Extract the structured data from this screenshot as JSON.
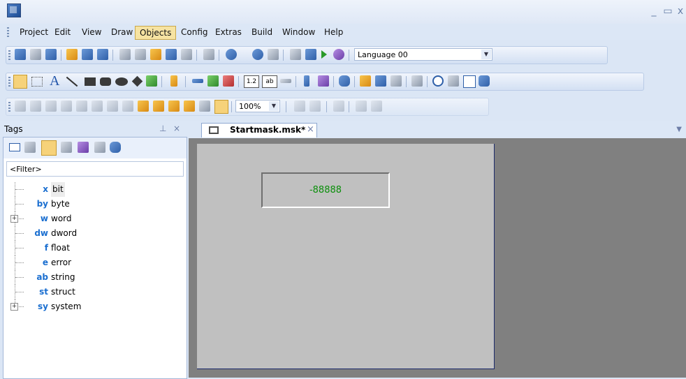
{
  "menu": [
    "Project",
    "Edit",
    "View",
    "Draw",
    "Objects",
    "Config",
    "Extras",
    "Build",
    "Window",
    "Help"
  ],
  "menu_active": "Objects",
  "toolbar1": {
    "language": "Language 00"
  },
  "toolbar3": {
    "zoom": "100%"
  },
  "tags_panel": {
    "title": "Tags",
    "filter_placeholder": "<Filter>",
    "items": [
      {
        "abbr": "x",
        "label": "bit",
        "expandable": false
      },
      {
        "abbr": "by",
        "label": "byte",
        "expandable": false
      },
      {
        "abbr": "w",
        "label": "word",
        "expandable": true
      },
      {
        "abbr": "dw",
        "label": "dword",
        "expandable": false
      },
      {
        "abbr": "f",
        "label": "float",
        "expandable": false
      },
      {
        "abbr": "e",
        "label": "error",
        "expandable": false
      },
      {
        "abbr": "ab",
        "label": "string",
        "expandable": false
      },
      {
        "abbr": "st",
        "label": "struct",
        "expandable": false
      },
      {
        "abbr": "sy",
        "label": "system",
        "expandable": true
      }
    ]
  },
  "document": {
    "tab_title": "Startmask.msk*",
    "display_value": "-88888"
  },
  "colors": {
    "display_text": "#0a8f0a",
    "canvas": "#c0c0c0",
    "workspace": "#808080"
  }
}
